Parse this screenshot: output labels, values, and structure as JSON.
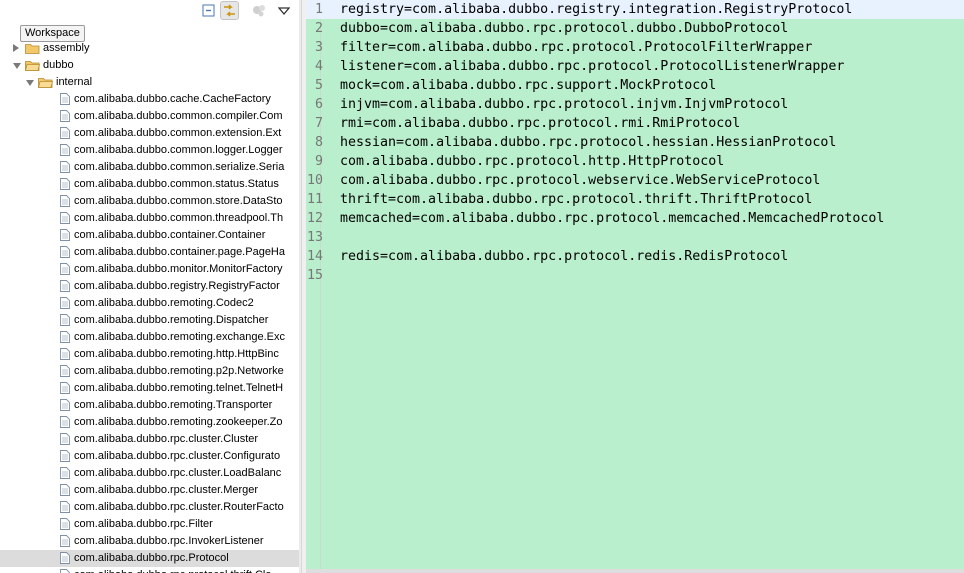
{
  "tree": {
    "workspace_tooltip": "Workspace",
    "nodes": [
      {
        "label": "assembly",
        "kind": "folder",
        "expanded": false,
        "depth": 0
      },
      {
        "label": "dubbo",
        "kind": "folder",
        "expanded": true,
        "depth": 0
      },
      {
        "label": "internal",
        "kind": "folder",
        "expanded": true,
        "depth": 1
      },
      {
        "label": "com.alibaba.dubbo.cache.CacheFactory",
        "kind": "file",
        "depth": 2
      },
      {
        "label": "com.alibaba.dubbo.common.compiler.Com",
        "kind": "file",
        "depth": 2
      },
      {
        "label": "com.alibaba.dubbo.common.extension.Ext",
        "kind": "file",
        "depth": 2
      },
      {
        "label": "com.alibaba.dubbo.common.logger.Logger",
        "kind": "file",
        "depth": 2
      },
      {
        "label": "com.alibaba.dubbo.common.serialize.Seria",
        "kind": "file",
        "depth": 2
      },
      {
        "label": "com.alibaba.dubbo.common.status.Status",
        "kind": "file",
        "depth": 2
      },
      {
        "label": "com.alibaba.dubbo.common.store.DataSto",
        "kind": "file",
        "depth": 2
      },
      {
        "label": "com.alibaba.dubbo.common.threadpool.Th",
        "kind": "file",
        "depth": 2
      },
      {
        "label": "com.alibaba.dubbo.container.Container",
        "kind": "file",
        "depth": 2
      },
      {
        "label": "com.alibaba.dubbo.container.page.PageHa",
        "kind": "file",
        "depth": 2
      },
      {
        "label": "com.alibaba.dubbo.monitor.MonitorFactory",
        "kind": "file",
        "depth": 2
      },
      {
        "label": "com.alibaba.dubbo.registry.RegistryFactor",
        "kind": "file",
        "depth": 2
      },
      {
        "label": "com.alibaba.dubbo.remoting.Codec2",
        "kind": "file",
        "depth": 2
      },
      {
        "label": "com.alibaba.dubbo.remoting.Dispatcher",
        "kind": "file",
        "depth": 2
      },
      {
        "label": "com.alibaba.dubbo.remoting.exchange.Exc",
        "kind": "file",
        "depth": 2
      },
      {
        "label": "com.alibaba.dubbo.remoting.http.HttpBinc",
        "kind": "file",
        "depth": 2
      },
      {
        "label": "com.alibaba.dubbo.remoting.p2p.Networke",
        "kind": "file",
        "depth": 2
      },
      {
        "label": "com.alibaba.dubbo.remoting.telnet.TelnetH",
        "kind": "file",
        "depth": 2
      },
      {
        "label": "com.alibaba.dubbo.remoting.Transporter",
        "kind": "file",
        "depth": 2
      },
      {
        "label": "com.alibaba.dubbo.remoting.zookeeper.Zo",
        "kind": "file",
        "depth": 2
      },
      {
        "label": "com.alibaba.dubbo.rpc.cluster.Cluster",
        "kind": "file",
        "depth": 2
      },
      {
        "label": "com.alibaba.dubbo.rpc.cluster.Configurato",
        "kind": "file",
        "depth": 2
      },
      {
        "label": "com.alibaba.dubbo.rpc.cluster.LoadBalanc",
        "kind": "file",
        "depth": 2
      },
      {
        "label": "com.alibaba.dubbo.rpc.cluster.Merger",
        "kind": "file",
        "depth": 2
      },
      {
        "label": "com.alibaba.dubbo.rpc.cluster.RouterFacto",
        "kind": "file",
        "depth": 2
      },
      {
        "label": "com.alibaba.dubbo.rpc.Filter",
        "kind": "file",
        "depth": 2
      },
      {
        "label": "com.alibaba.dubbo.rpc.InvokerListener",
        "kind": "file",
        "depth": 2
      },
      {
        "label": "com.alibaba.dubbo.rpc.Protocol",
        "kind": "file",
        "depth": 2,
        "selected": true
      },
      {
        "label": "com.alibaba.dubbo.rpc.protocol.thrift.Cla",
        "kind": "file",
        "depth": 2
      }
    ]
  },
  "editor": {
    "current_line": 1,
    "lines": [
      {
        "num": "1",
        "text": "registry=com.alibaba.dubbo.registry.integration.RegistryProtocol"
      },
      {
        "num": "2",
        "text": "dubbo=com.alibaba.dubbo.rpc.protocol.dubbo.DubboProtocol"
      },
      {
        "num": "3",
        "text": "filter=com.alibaba.dubbo.rpc.protocol.ProtocolFilterWrapper"
      },
      {
        "num": "4",
        "text": "listener=com.alibaba.dubbo.rpc.protocol.ProtocolListenerWrapper"
      },
      {
        "num": "5",
        "text": "mock=com.alibaba.dubbo.rpc.support.MockProtocol"
      },
      {
        "num": "6",
        "text": "injvm=com.alibaba.dubbo.rpc.protocol.injvm.InjvmProtocol"
      },
      {
        "num": "7",
        "text": "rmi=com.alibaba.dubbo.rpc.protocol.rmi.RmiProtocol"
      },
      {
        "num": "8",
        "text": "hessian=com.alibaba.dubbo.rpc.protocol.hessian.HessianProtocol"
      },
      {
        "num": "9",
        "text": "com.alibaba.dubbo.rpc.protocol.http.HttpProtocol"
      },
      {
        "num": "10",
        "text": "com.alibaba.dubbo.rpc.protocol.webservice.WebServiceProtocol"
      },
      {
        "num": "11",
        "text": "thrift=com.alibaba.dubbo.rpc.protocol.thrift.ThriftProtocol"
      },
      {
        "num": "12",
        "text": "memcached=com.alibaba.dubbo.rpc.protocol.memcached.MemcachedProtocol"
      },
      {
        "num": "13",
        "text": ""
      },
      {
        "num": "14",
        "text": "redis=com.alibaba.dubbo.rpc.protocol.redis.RedisProtocol"
      },
      {
        "num": "15",
        "text": ""
      }
    ]
  }
}
